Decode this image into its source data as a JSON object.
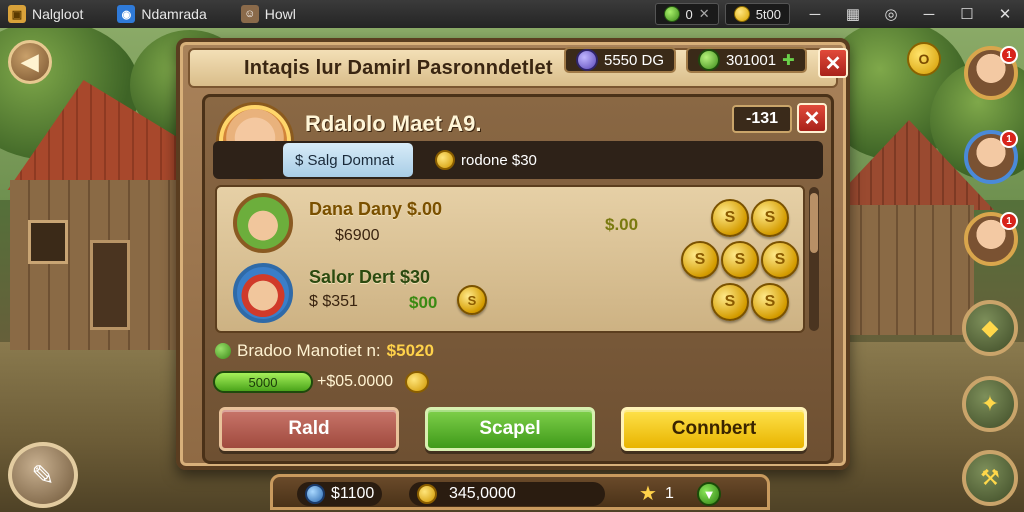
{
  "os_bar": {
    "app1": "Nalgloot",
    "app2": "Ndamrada",
    "app3": "Howl",
    "res1_value": "0",
    "res2_value": "5t00",
    "minimize": "─",
    "maximize": "☐",
    "close": "✕"
  },
  "dialog": {
    "title": "Intaqis lur Damirl  Pasronndetlet",
    "gem_value": "5550 DG",
    "green_value": "301001",
    "close_label": "✕"
  },
  "profile": {
    "name": "Rdalolo Maet  A9.",
    "level": "-131",
    "close_label": "✕"
  },
  "tabs": [
    {
      "label": "$ Salg Domnat"
    },
    {
      "label": "rodone $30"
    }
  ],
  "rows": [
    {
      "name": "Dana Dany $.00",
      "value": "$6900",
      "green": "$.00"
    },
    {
      "name": "Salor Dert $30",
      "value": "$ $351",
      "green": "$00"
    }
  ],
  "coin_glyph": "S",
  "summary": {
    "label": "Bradoo Manotiet n:",
    "amount": "$5020",
    "progress_label": "5000",
    "progress_value": "+$05.0000"
  },
  "buttons": {
    "left": "Rald",
    "middle": "Scapel",
    "right": "Connbert"
  },
  "bottom_bar": {
    "res1": "$1100",
    "res2": "345,0000",
    "res3": "1"
  },
  "side": {
    "gold_label": "O",
    "badge1": "1",
    "badge2": "1",
    "badge3": "1"
  }
}
